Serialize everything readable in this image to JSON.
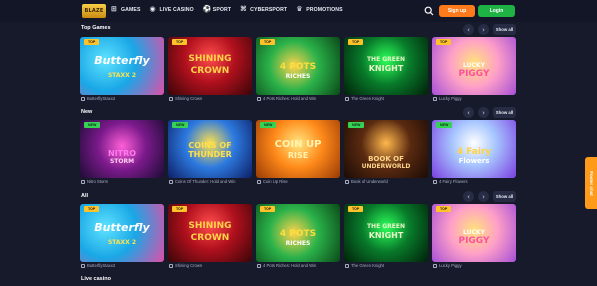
{
  "header": {
    "logo_text": "BLAZE",
    "nav": [
      {
        "label": "GAMES",
        "icon": "gamepad-icon"
      },
      {
        "label": "LIVE CASINO",
        "icon": "live-icon"
      },
      {
        "label": "SPORT",
        "icon": "ball-icon"
      },
      {
        "label": "CYBERSPORT",
        "icon": "joystick-icon"
      },
      {
        "label": "PROMOTIONS",
        "icon": "trophy-icon"
      }
    ],
    "signup_label": "Sign up",
    "login_label": "Login"
  },
  "sections": [
    {
      "title": "Top Games",
      "show_all": "Show all",
      "games": [
        {
          "badge": "TOP",
          "title": "Butterfly",
          "sub": "STAXX 2",
          "caption": "ButterflyStaxx2"
        },
        {
          "badge": "TOP",
          "title": "SHINING",
          "sub": "CROWN",
          "caption": "Shining Crown"
        },
        {
          "badge": "TOP",
          "title": "4 POTS",
          "sub": "RICHES",
          "caption": "4 Pots Riches: Hold and Win"
        },
        {
          "badge": "TOP",
          "title": "THE GREEN",
          "sub": "KNIGHT",
          "caption": "The Green Knight"
        },
        {
          "badge": "TOP",
          "title": "LUCKY",
          "sub": "PIGGY",
          "caption": "Lucky Piggy"
        }
      ]
    },
    {
      "title": "New",
      "show_all": "Show all",
      "games": [
        {
          "badge": "NEW",
          "title": "NITRO",
          "sub": "STORM",
          "caption": "Nitro Storm"
        },
        {
          "badge": "NEW",
          "title": "COINS OF",
          "sub": "THUNDER",
          "caption": "Coins Of Thunder: Hold and Win"
        },
        {
          "badge": "NEW",
          "title": "COIN UP",
          "sub": "RISE",
          "caption": "Coin Up Rise"
        },
        {
          "badge": "NEW",
          "title": "BOOK OF",
          "sub": "UNDERWORLD",
          "caption": "Book of Underworld"
        },
        {
          "badge": "NEW",
          "title": "4 Fairy",
          "sub": "Flowers",
          "caption": "4 Fairy Flowers"
        }
      ]
    },
    {
      "title": "All",
      "show_all": "Show all",
      "games": [
        {
          "badge": "TOP",
          "title": "Butterfly",
          "sub": "STAXX 2",
          "caption": "ButterflyStaxx2"
        },
        {
          "badge": "TOP",
          "title": "SHINING",
          "sub": "CROWN",
          "caption": "Shining Crown"
        },
        {
          "badge": "TOP",
          "title": "4 POTS",
          "sub": "RICHES",
          "caption": "4 Pots Riches: Hold and Win"
        },
        {
          "badge": "TOP",
          "title": "THE GREEN",
          "sub": "KNIGHT",
          "caption": "The Green Knight"
        },
        {
          "badge": "TOP",
          "title": "LUCKY",
          "sub": "PIGGY",
          "caption": "Lucky Piggy"
        }
      ]
    },
    {
      "title": "Live casino"
    }
  ],
  "side_tab": "Footer chat",
  "colors": {
    "accent_orange": "#ff7a1a",
    "login_green": "#1fb346",
    "background": "#161a2b"
  }
}
